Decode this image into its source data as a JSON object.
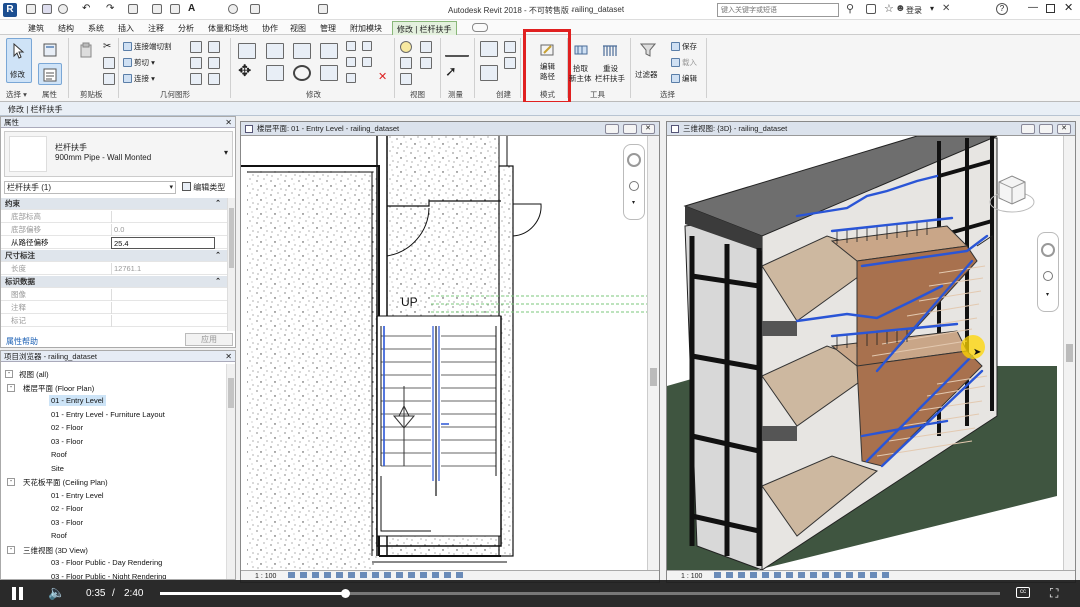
{
  "titlebar": {
    "title": "Autodesk Revit 2018 -  不可转售版 -",
    "file": "railing_dataset",
    "search_placeholder": "键入关键字或短语",
    "login": "登录"
  },
  "menu": {
    "items": [
      "建筑",
      "结构",
      "系统",
      "插入",
      "注释",
      "分析",
      "体量和场地",
      "协作",
      "视图",
      "管理",
      "附加模块"
    ],
    "active": "修改 | 栏杆扶手"
  },
  "ribbon": {
    "modify": "修改",
    "groups": [
      "选择 ▾",
      "属性",
      "剪贴板",
      "几何图形",
      "修改",
      "视图",
      "测量",
      "创建",
      "模式",
      "工具",
      "选择"
    ],
    "geometry_items": [
      "连接端切割",
      "剪切",
      "连接"
    ],
    "edit_path": [
      "编辑",
      "路径"
    ],
    "mode": "模式",
    "pick_host": [
      "拾取",
      "新主体"
    ],
    "reset": [
      "重设",
      "栏杆扶手"
    ],
    "filter": "过滤器",
    "select_items": [
      "保存",
      "载入",
      "编辑"
    ],
    "highlight_color": "#e02020"
  },
  "context_bar": "修改 | 栏杆扶手",
  "properties": {
    "title": "属性",
    "type_name": "栏杆扶手",
    "type_sub": "900mm Pipe - Wall Monted",
    "instance_filter": "栏杆扶手 (1)",
    "edit_type": "编辑类型",
    "rows": [
      {
        "kind": "hdr",
        "label": "约束"
      },
      {
        "kind": "row",
        "label": "底部标高",
        "value": ""
      },
      {
        "kind": "row",
        "label": "底部偏移",
        "value": "0.0"
      },
      {
        "kind": "row",
        "label": "从路径偏移",
        "value": "25.4",
        "active": true
      },
      {
        "kind": "hdr",
        "label": "尺寸标注"
      },
      {
        "kind": "row",
        "label": "长度",
        "value": "12761.1"
      },
      {
        "kind": "hdr",
        "label": "标识数据"
      },
      {
        "kind": "row",
        "label": "图像",
        "value": ""
      },
      {
        "kind": "row",
        "label": "注释",
        "value": ""
      },
      {
        "kind": "row",
        "label": "标记",
        "value": ""
      }
    ],
    "help": "属性帮助",
    "apply": "应用"
  },
  "browser": {
    "title": "项目浏览器 - railing_dataset",
    "items": [
      {
        "t": "视图 (all)",
        "l": 0,
        "tog": "-"
      },
      {
        "t": "楼层平面 (Floor Plan)",
        "l": 1,
        "tog": "-"
      },
      {
        "t": "01 - Entry Level",
        "l": 2,
        "sel": true
      },
      {
        "t": "01 - Entry Level - Furniture Layout",
        "l": 2
      },
      {
        "t": "02 - Floor",
        "l": 2
      },
      {
        "t": "03 - Floor",
        "l": 2
      },
      {
        "t": "Roof",
        "l": 2
      },
      {
        "t": "Site",
        "l": 2
      },
      {
        "t": "天花板平面 (Ceiling Plan)",
        "l": 1,
        "tog": "-"
      },
      {
        "t": "01 - Entry Level",
        "l": 2
      },
      {
        "t": "02 - Floor",
        "l": 2
      },
      {
        "t": "03 - Floor",
        "l": 2
      },
      {
        "t": "Roof",
        "l": 2
      },
      {
        "t": "三维视图 (3D View)",
        "l": 1,
        "tog": "-"
      },
      {
        "t": "03 - Floor Public - Day Rendering",
        "l": 2
      },
      {
        "t": "03 - Floor Public - Night Rendering",
        "l": 2
      }
    ]
  },
  "view_plan": {
    "title": "楼层平面: 01 - Entry Level - railing_dataset",
    "up_label": "UP",
    "scale": "1 : 100"
  },
  "view_3d": {
    "title": "三维视图: {3D} - railing_dataset",
    "scale": "1 : 100"
  },
  "player": {
    "current": "0:35",
    "separator": "/",
    "total": "2:40",
    "progress": 0.22
  }
}
